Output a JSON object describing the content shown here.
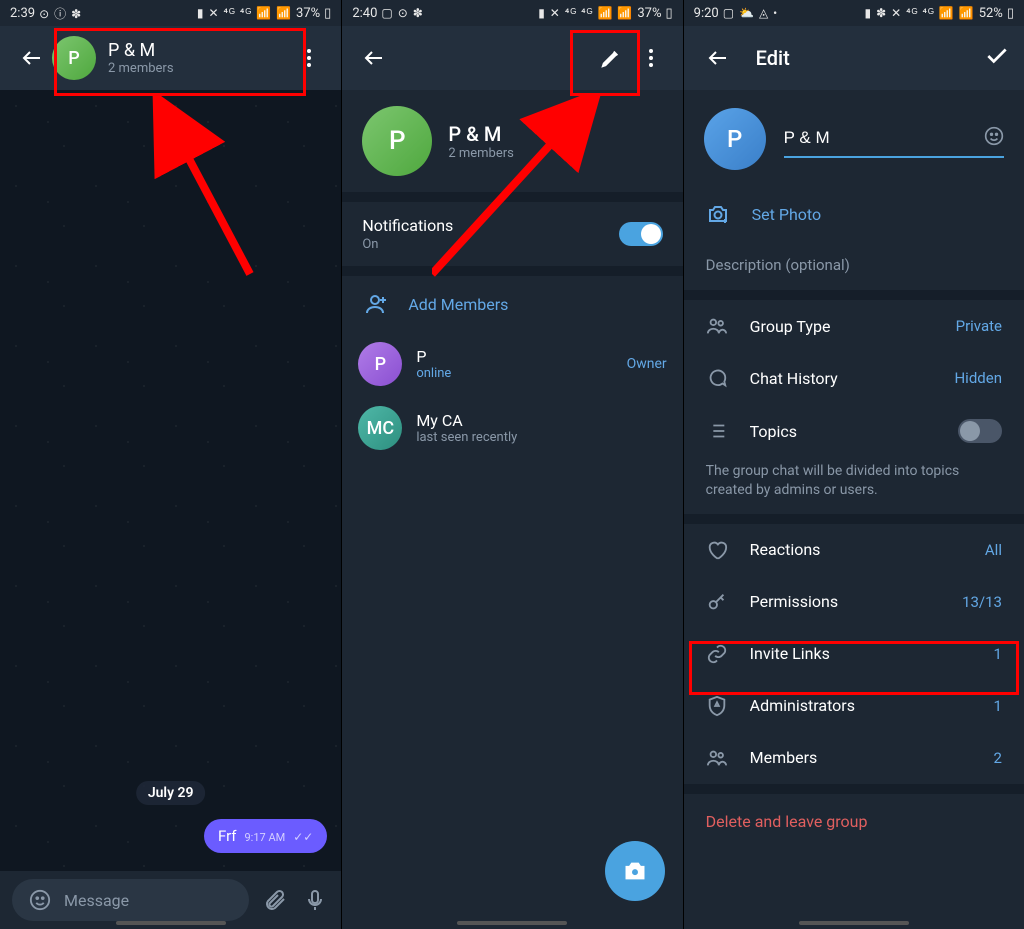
{
  "pane1": {
    "status": {
      "time": "2:39",
      "left_icons": "⊙ ⓘ ✽",
      "right_icons": "▮ ✕ ⁴ᴳ ⁴ᴳ 📶 📶",
      "battery": "37%",
      "batt_icon": "▯"
    },
    "header": {
      "title": "P & M",
      "subtitle": "2 members",
      "avatar_letter": "P"
    },
    "date_chip": "July 29",
    "msg": {
      "text": "Frf",
      "time": "9:17 AM",
      "ticks": "✓✓"
    },
    "input_placeholder": "Message"
  },
  "pane2": {
    "status": {
      "time": "2:40",
      "left_icons": "▢ ⊙ ✽",
      "right_icons": "▮ ✕ ⁴ᴳ ⁴ᴳ 📶 📶",
      "battery": "37%",
      "batt_icon": "▯"
    },
    "profile": {
      "title": "P & M",
      "subtitle": "2 members",
      "avatar_letter": "P"
    },
    "notifications": {
      "label": "Notifications",
      "value": "On"
    },
    "add_members": "Add Members",
    "members": [
      {
        "avatar": "P",
        "name": "P",
        "sub": "online",
        "role": "Owner"
      },
      {
        "avatar": "MC",
        "name": "My CA",
        "sub": "last seen recently",
        "role": ""
      }
    ]
  },
  "pane3": {
    "status": {
      "time": "9:20",
      "left_icons": "▢ ⛅ ◬ •",
      "right_icons": "▮ ✽ ✕ ⁴ᴳ ⁴ᴳ 📶 📶",
      "battery": "52%",
      "batt_icon": "▯"
    },
    "header_title": "Edit",
    "avatar_letter": "P",
    "name_value": "P & M",
    "set_photo": "Set Photo",
    "description_placeholder": "Description (optional)",
    "settings": {
      "group_type": {
        "label": "Group Type",
        "value": "Private"
      },
      "chat_history": {
        "label": "Chat History",
        "value": "Hidden"
      },
      "topics": {
        "label": "Topics"
      },
      "topics_hint": "The group chat will be divided into topics created by admins or users.",
      "reactions": {
        "label": "Reactions",
        "value": "All"
      },
      "permissions": {
        "label": "Permissions",
        "value": "13/13"
      },
      "invite_links": {
        "label": "Invite Links",
        "value": "1"
      },
      "administrators": {
        "label": "Administrators",
        "value": "1"
      },
      "members": {
        "label": "Members",
        "value": "2"
      }
    },
    "delete": "Delete and leave group"
  }
}
